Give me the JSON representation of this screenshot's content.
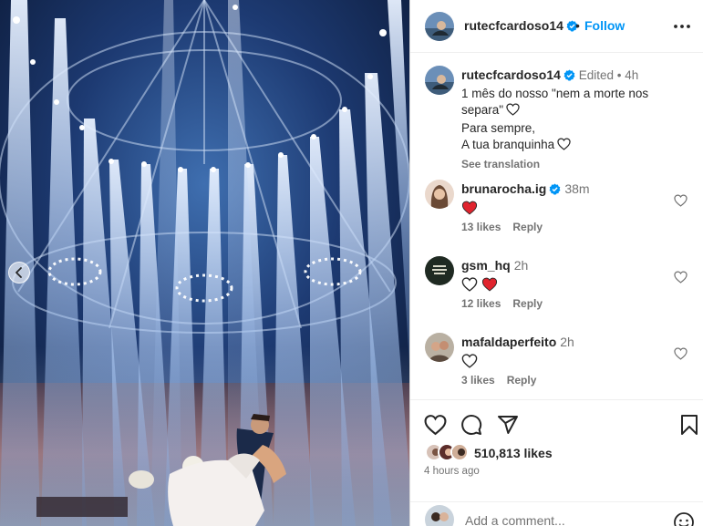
{
  "post": {
    "username": "rutecfcardoso14",
    "follow_label": "Follow",
    "separator": "•",
    "more_label": "More options",
    "caption": {
      "meta": "Edited • 4h",
      "line1": "1 mês do nosso \"nem a morte nos separa\"",
      "line2": "Para sempre,",
      "line3": "A tua branquinha",
      "see_translation": "See translation"
    }
  },
  "comments": [
    {
      "username": "brunarocha.ig",
      "verified": true,
      "time": "38m",
      "emoji": "red-heart",
      "likes": "13 likes",
      "reply": "Reply"
    },
    {
      "username": "gsm_hq",
      "verified": false,
      "time": "2h",
      "emoji": "white-heart red-heart",
      "likes": "12 likes",
      "reply": "Reply"
    },
    {
      "username": "mafaldaperfeito",
      "verified": false,
      "time": "2h",
      "emoji": "white-heart",
      "likes": "3 likes",
      "reply": "Reply"
    }
  ],
  "footer": {
    "likes": "510,813 likes",
    "time_ago": "4 hours ago",
    "add_comment_placeholder": "Add a comment..."
  },
  "colors": {
    "accent": "#0095f6",
    "heart": "#ed4956",
    "muted": "#737373"
  }
}
